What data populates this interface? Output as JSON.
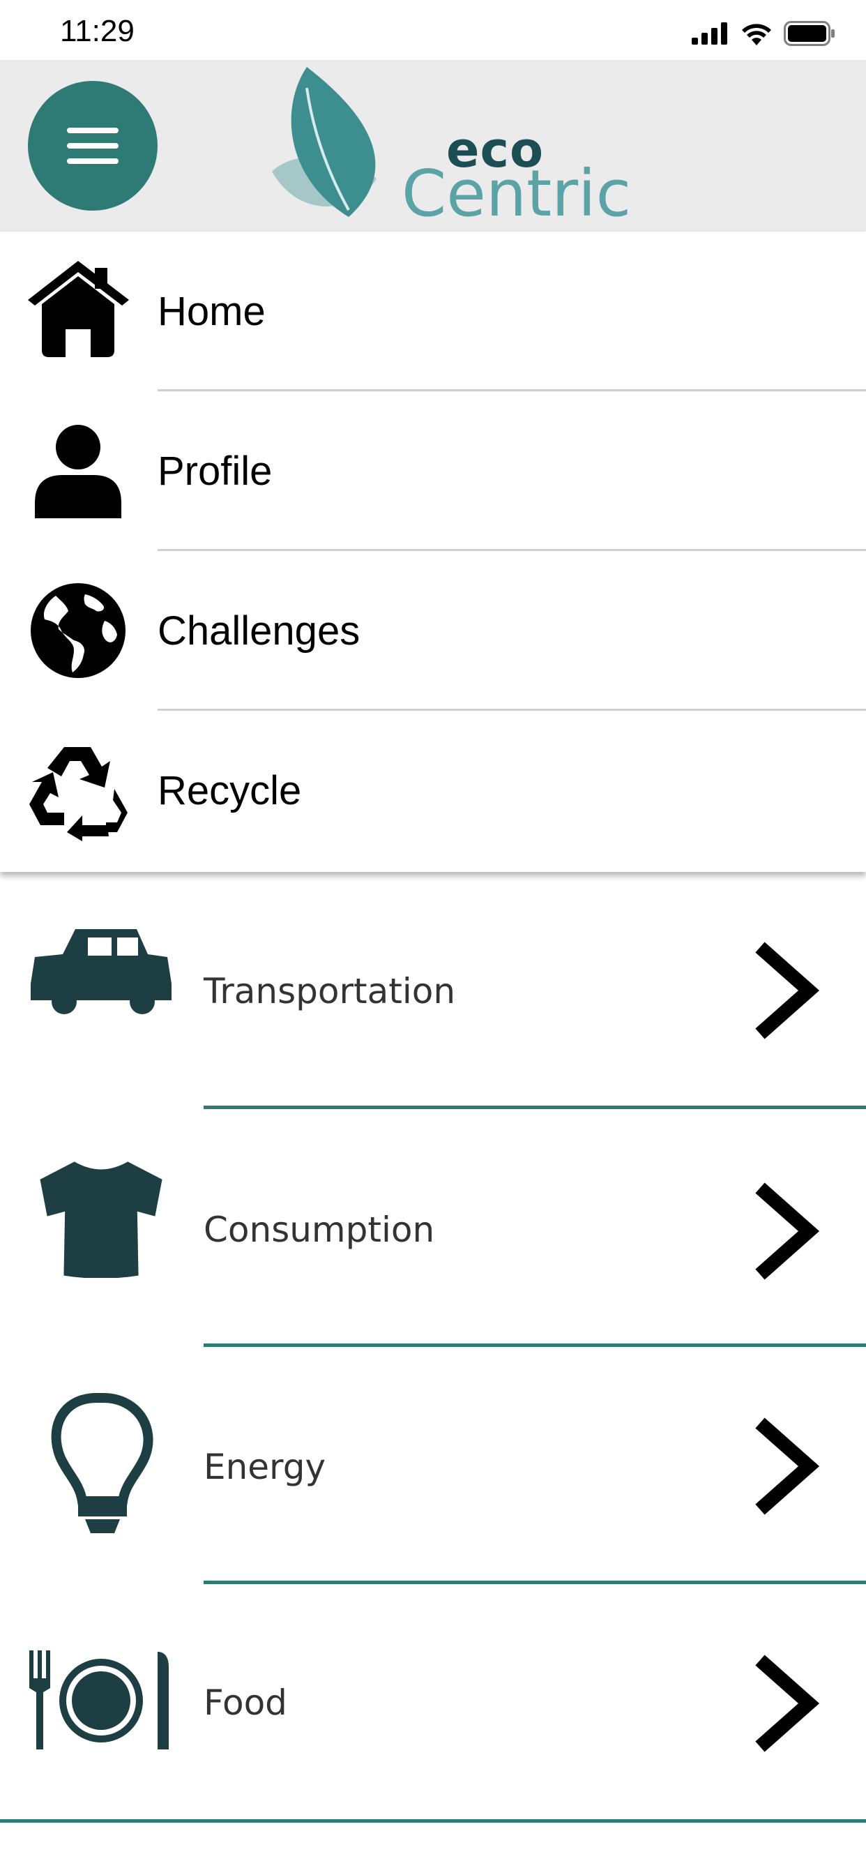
{
  "status_bar": {
    "time": "11:29",
    "icons": [
      "cellular-signal-icon",
      "wifi-icon",
      "battery-icon"
    ]
  },
  "header": {
    "menu_icon": "hamburger-menu-icon",
    "logo": {
      "line1": "eco",
      "line2": "Centric",
      "icon": "leaf-logo-icon"
    },
    "background_color": "#ebebeb",
    "accent_color": "#2e7a74"
  },
  "drawer": {
    "items": [
      {
        "label": "Home",
        "icon": "home-icon"
      },
      {
        "label": "Profile",
        "icon": "user-icon"
      },
      {
        "label": "Challenges",
        "icon": "globe-icon"
      },
      {
        "label": "Recycle",
        "icon": "recycle-icon"
      }
    ]
  },
  "categories": [
    {
      "label": "Transportation",
      "icon": "car-icon"
    },
    {
      "label": "Consumption",
      "icon": "tshirt-icon"
    },
    {
      "label": "Energy",
      "icon": "lightbulb-icon"
    },
    {
      "label": "Food",
      "icon": "utensils-plate-icon"
    }
  ],
  "colors": {
    "icon_dark_teal": "#1d3f44",
    "divider_teal": "#2e7a74",
    "logo_dark": "#1d4d55",
    "logo_light": "#5ba3a5"
  }
}
